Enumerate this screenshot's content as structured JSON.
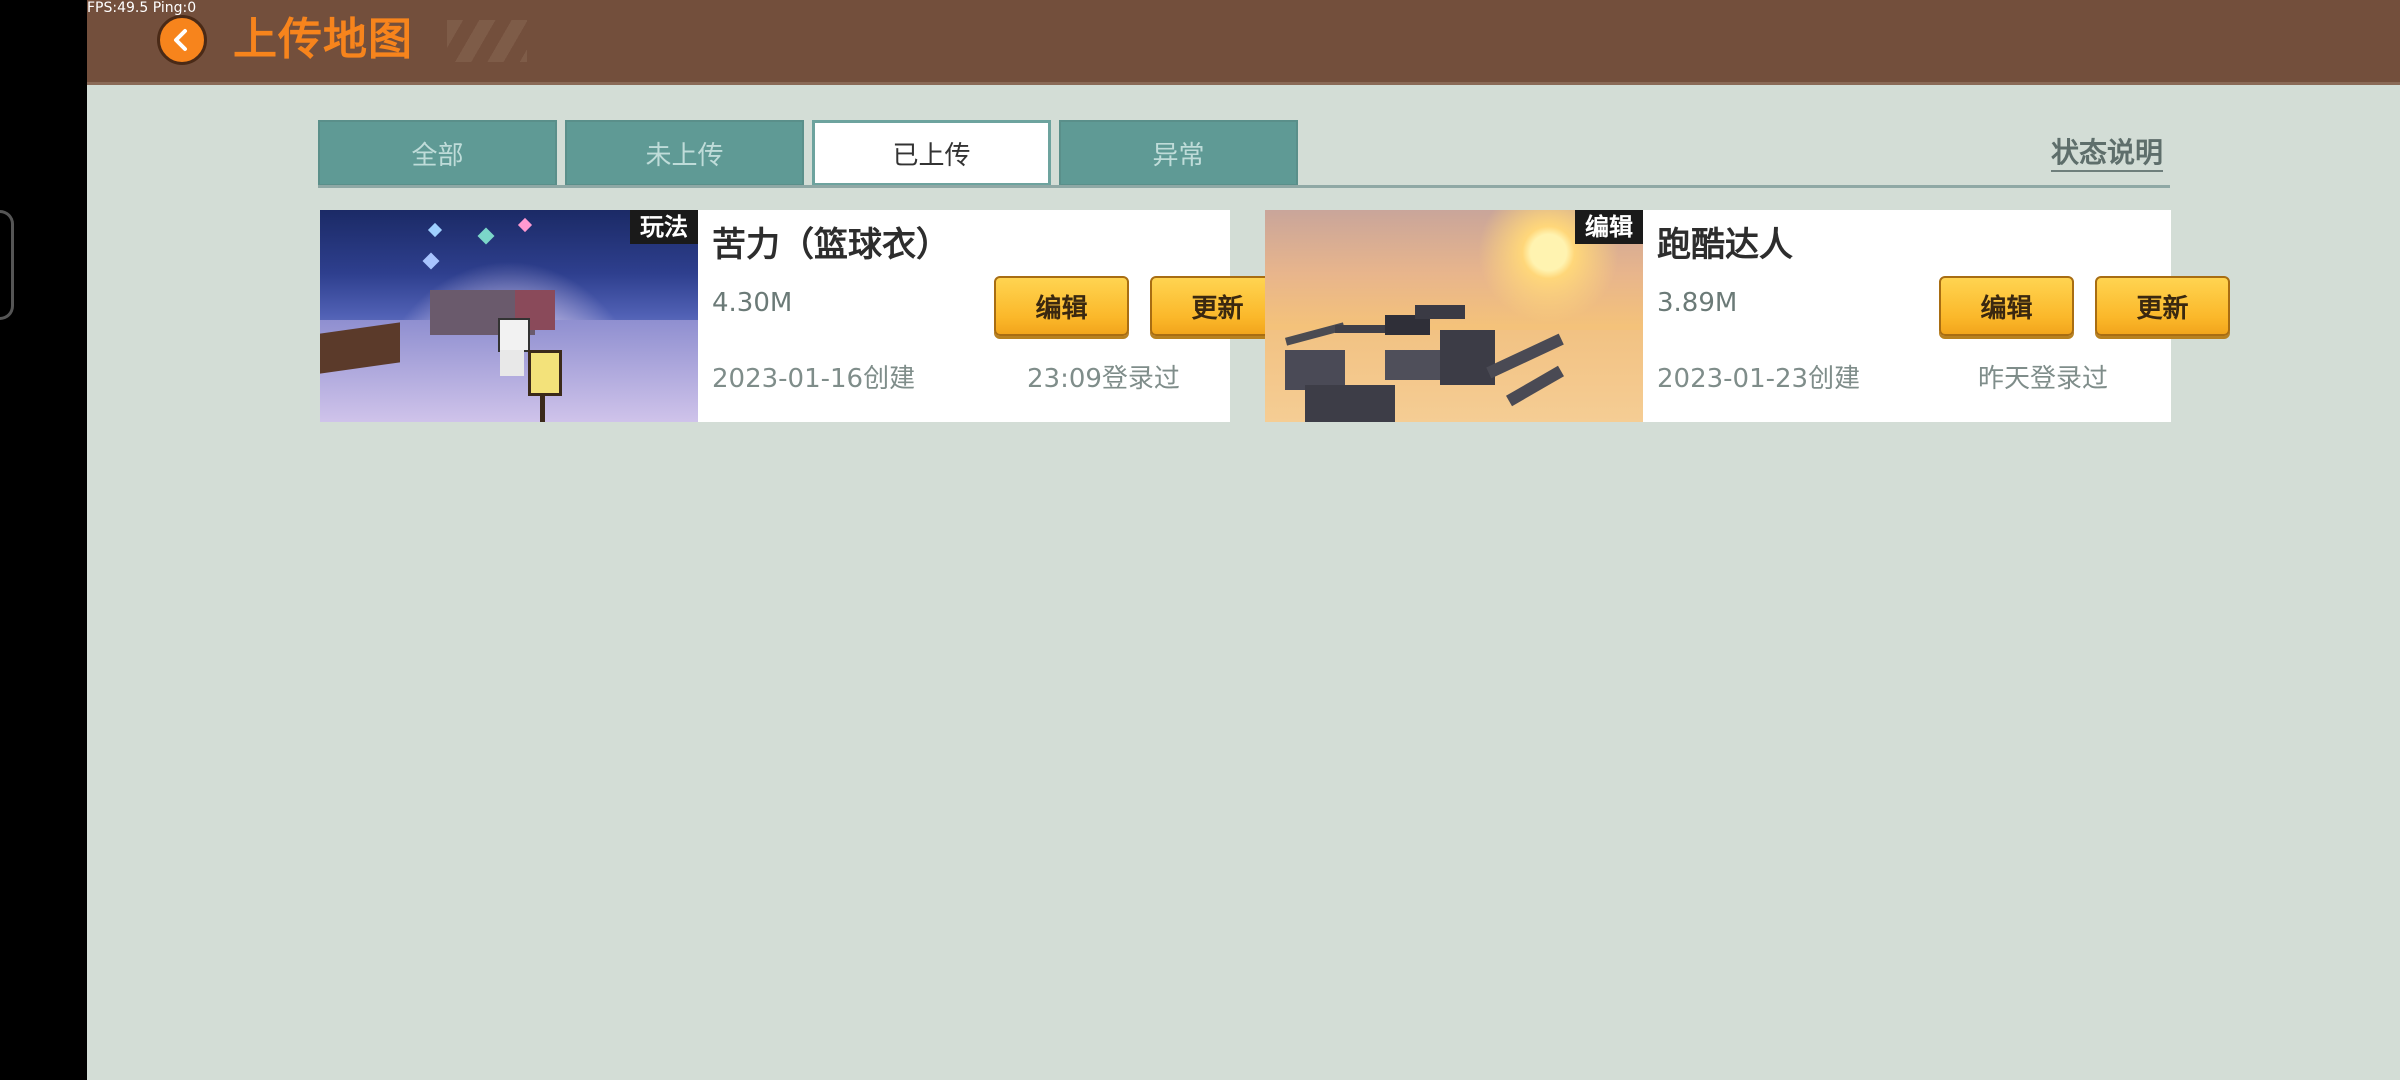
{
  "debug": {
    "fps_text": "FPS:49.5  Ping:0"
  },
  "header": {
    "title": "上传地图",
    "back_icon": "chevron-left-icon"
  },
  "tabs": [
    {
      "label": "全部",
      "active": false
    },
    {
      "label": "未上传",
      "active": false
    },
    {
      "label": "已上传",
      "active": true
    },
    {
      "label": "异常",
      "active": false
    }
  ],
  "status_link": "状态说明",
  "maps": [
    {
      "tag": "玩法",
      "title": "苦力（篮球衣）",
      "size": "4.30M",
      "created": "2023-01-16创建",
      "last_login": "23:09登录过",
      "edit_label": "编辑",
      "update_label": "更新"
    },
    {
      "tag": "编辑",
      "title": "跑酷达人",
      "size": "3.89M",
      "created": "2023-01-23创建",
      "last_login": "昨天登录过",
      "edit_label": "编辑",
      "update_label": "更新"
    }
  ],
  "colors": {
    "header_bg": "#734f3c",
    "title_orange": "#f7841c",
    "tab_bg": "#5f9a95",
    "page_bg": "#d3ddd6",
    "button_yellow": "#fbb82a"
  }
}
